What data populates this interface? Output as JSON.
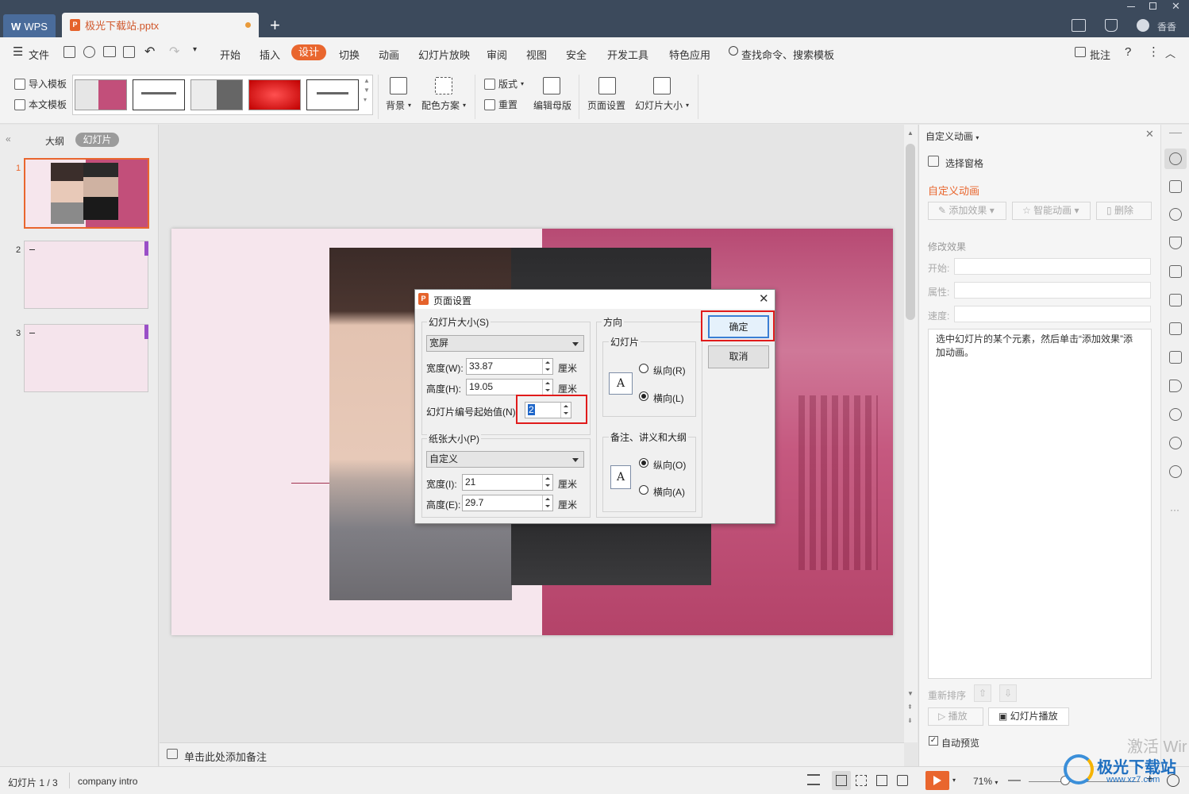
{
  "titlebar": {
    "app_name": "WPS",
    "doc_tab": "极光下载站.pptx",
    "user": "香香"
  },
  "menu": {
    "file": "文件",
    "items": [
      "开始",
      "插入",
      "设计",
      "切换",
      "动画",
      "幻灯片放映",
      "审阅",
      "视图",
      "安全",
      "开发工具",
      "特色应用"
    ],
    "search": "查找命令、搜索模板",
    "comment": "批注"
  },
  "ribbon": {
    "import_template": "导入模板",
    "this_template": "本文模板",
    "background": "背景",
    "color_scheme": "配色方案",
    "layout": "版式",
    "reset": "重置",
    "edit_master": "编辑母版",
    "page_setup": "页面设置",
    "slide_size": "幻灯片大小"
  },
  "left_panel": {
    "tab_outline": "大纲",
    "tab_slides": "幻灯片",
    "slide_numbers": [
      "1",
      "2",
      "3"
    ]
  },
  "notes": {
    "placeholder": "单击此处添加备注"
  },
  "right_panel": {
    "title": "自定义动画",
    "select_pane": "选择窗格",
    "section_title": "自定义动画",
    "add_effect": "添加效果",
    "smart_anim": "智能动画",
    "delete": "删除",
    "modify_effect": "修改效果",
    "start_label": "开始:",
    "property_label": "属性:",
    "speed_label": "速度:",
    "hint": "选中幻灯片的某个元素，然后单击“添加效果”添加动画。",
    "reorder": "重新排序",
    "play": "播放",
    "slideshow": "幻灯片播放",
    "auto_preview": "自动预览"
  },
  "dialog": {
    "title": "页面设置",
    "slide_size_group": "幻灯片大小(S)",
    "slide_size_value": "宽屏",
    "width_label": "宽度(W):",
    "width_value": "33.87",
    "height_label": "高度(H):",
    "height_value": "19.05",
    "unit": "厘米",
    "number_start_label": "幻灯片编号起始值(N):",
    "number_start_value": "2",
    "paper_size_group": "纸张大小(P)",
    "paper_size_value": "自定义",
    "paper_width_label": "宽度(I):",
    "paper_width_value": "21",
    "paper_height_label": "高度(E):",
    "paper_height_value": "29.7",
    "orientation_group": "方向",
    "slides_group": "幻灯片",
    "portrait_r": "纵向(R)",
    "landscape_l": "横向(L)",
    "notes_group": "备注、讲义和大纲",
    "portrait_o": "纵向(O)",
    "landscape_a": "横向(A)",
    "ok": "确定",
    "cancel": "取消"
  },
  "statusbar": {
    "slide_info": "幻灯片 1 / 3",
    "theme": "company intro",
    "zoom": "71%"
  },
  "watermark": {
    "activate": "激活 Wir",
    "site": "极光下载站",
    "url": "www.xz7.com"
  },
  "colors": {
    "accent": "#e9662e",
    "titlebar": "#3c4a5c",
    "highlight": "#e01b1b"
  }
}
